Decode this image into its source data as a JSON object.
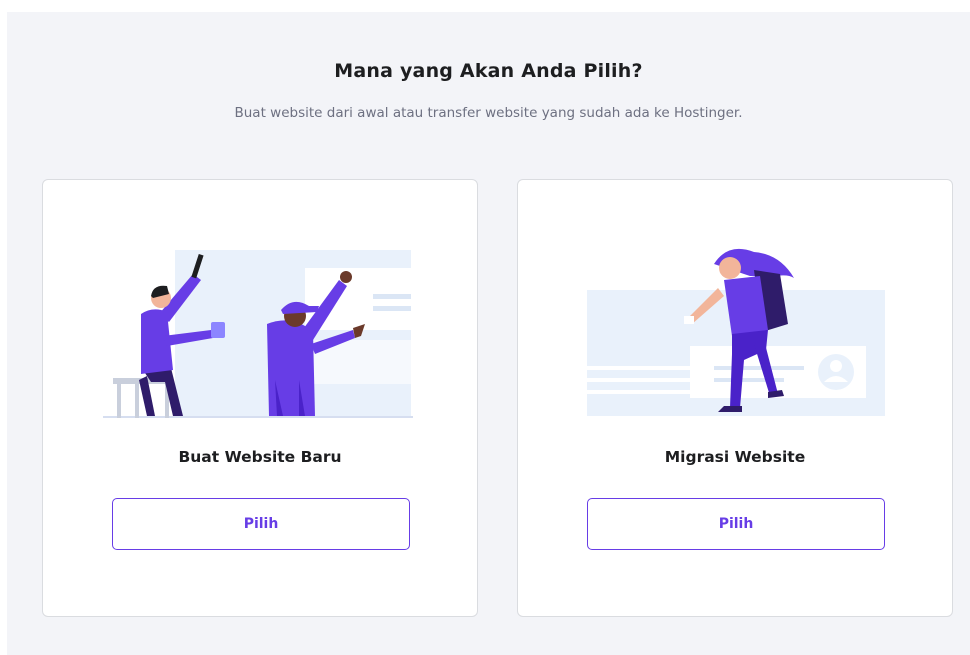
{
  "header": {
    "title": "Mana yang Akan Anda Pilih?",
    "subtitle": "Buat website dari awal atau transfer website yang sudah ada ke Hostinger."
  },
  "options": [
    {
      "title": "Buat Website Baru",
      "button_label": "Pilih",
      "illustration": "builders-illustration"
    },
    {
      "title": "Migrasi Website",
      "button_label": "Pilih",
      "illustration": "migration-illustration"
    }
  ],
  "colors": {
    "accent": "#673de6",
    "accent_dark": "#4a22c9",
    "background": "#f3f4f8",
    "card": "#ffffff",
    "text": "#1d1e20",
    "muted": "#6d7081",
    "illustration_bg": "#e9f1fb"
  }
}
